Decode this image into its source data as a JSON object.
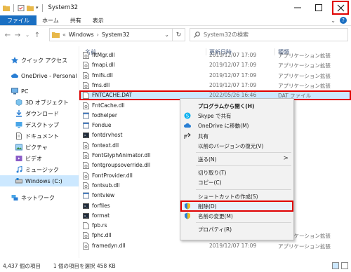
{
  "window": {
    "title": "System32",
    "title_icon": "folder-icon"
  },
  "ribbon": {
    "tabs": [
      {
        "label": "ファイル",
        "active": true
      },
      {
        "label": "ホーム"
      },
      {
        "label": "共有"
      },
      {
        "label": "表示"
      }
    ]
  },
  "address": {
    "crumbs": [
      "Windows",
      "System32"
    ],
    "prefix": "«",
    "search_placeholder": "System32の検索"
  },
  "nav": {
    "items": [
      {
        "label": "クイック アクセス",
        "icon": "star-icon"
      },
      {
        "label": "OneDrive - Personal",
        "icon": "cloud-icon"
      },
      {
        "label": "PC",
        "icon": "pc-icon"
      },
      {
        "label": "3D オブジェクト",
        "icon": "cube-icon"
      },
      {
        "label": "ダウンロード",
        "icon": "download-icon"
      },
      {
        "label": "デスクトップ",
        "icon": "desktop-icon"
      },
      {
        "label": "ドキュメント",
        "icon": "document-icon"
      },
      {
        "label": "ピクチャ",
        "icon": "picture-icon"
      },
      {
        "label": "ビデオ",
        "icon": "video-icon"
      },
      {
        "label": "ミュージック",
        "icon": "music-icon"
      },
      {
        "label": "Windows (C:)",
        "icon": "drive-icon",
        "selected": true
      },
      {
        "label": "ネットワーク",
        "icon": "network-icon"
      }
    ]
  },
  "list": {
    "columns": {
      "name": "名前",
      "date": "更新日時",
      "type": "種類"
    },
    "rows": [
      {
        "name": "fltMgr.dll",
        "date": "2019/12/07 17:09",
        "type": "アプリケーション拡張"
      },
      {
        "name": "fmapi.dll",
        "date": "2019/12/07 17:09",
        "type": "アプリケーション拡張"
      },
      {
        "name": "fmifs.dll",
        "date": "2019/12/07 17:09",
        "type": "アプリケーション拡張"
      },
      {
        "name": "fms.dll",
        "date": "2019/12/07 17:09",
        "type": "アプリケーション拡張"
      },
      {
        "name": "FNTCACHE.DAT",
        "date": "2022/05/26 16:46",
        "type": "DAT ファイル",
        "selected": true
      },
      {
        "name": "FntCache.dll",
        "date": "",
        "type": ""
      },
      {
        "name": "fodhelper",
        "date": "",
        "type": ""
      },
      {
        "name": "Fondue",
        "date": "",
        "type": ""
      },
      {
        "name": "fontdrvhost",
        "date": "",
        "type": ""
      },
      {
        "name": "fontext.dll",
        "date": "",
        "type": ""
      },
      {
        "name": "FontGlyphAnimator.dll",
        "date": "",
        "type": ""
      },
      {
        "name": "fontgroupsoverride.dll",
        "date": "",
        "type": ""
      },
      {
        "name": "FontProvider.dll",
        "date": "",
        "type": ""
      },
      {
        "name": "fontsub.dll",
        "date": "",
        "type": ""
      },
      {
        "name": "fontview",
        "date": "",
        "type": ""
      },
      {
        "name": "forfiles",
        "date": "",
        "type": ""
      },
      {
        "name": "format",
        "date": "",
        "type": ""
      },
      {
        "name": "fpb.rs",
        "date": "",
        "type": ""
      },
      {
        "name": "fphc.dll",
        "date": "2019/12/07 17:09",
        "type": "アプリケーション拡張"
      },
      {
        "name": "framedyn.dll",
        "date": "2019/12/07 17:09",
        "type": "アプリケーション拡張"
      }
    ]
  },
  "context_menu": {
    "items": [
      {
        "label": "プログラムから開く(H)",
        "icon": "",
        "bold": true
      },
      {
        "label": "Skype で共有",
        "icon": "skype-icon"
      },
      {
        "label": "OneDrive に移動(M)",
        "icon": "cloud-icon"
      },
      {
        "label": "共有",
        "icon": "share-icon"
      },
      {
        "label": "以前のバージョンの復元(V)",
        "icon": ""
      },
      {
        "sep": true
      },
      {
        "label": "送る(N)",
        "icon": "",
        "arrow": ">"
      },
      {
        "sep": true
      },
      {
        "label": "切り取り(T)",
        "icon": ""
      },
      {
        "label": "コピー(C)",
        "icon": ""
      },
      {
        "sep": true
      },
      {
        "label": "ショートカットの作成(S)",
        "icon": ""
      },
      {
        "label": "削除(D)",
        "icon": "shield-icon",
        "boxed": true
      },
      {
        "label": "名前の変更(M)",
        "icon": "shield-icon"
      },
      {
        "sep": true
      },
      {
        "label": "プロパティ(R)",
        "icon": ""
      }
    ]
  },
  "status": {
    "count": "4,437 個の項目",
    "selection": "1 個の項目を選択  458 KB"
  },
  "colors": {
    "accent": "#1a6fc2",
    "selection": "#cce8ff",
    "highlight_box": "#e00000"
  }
}
